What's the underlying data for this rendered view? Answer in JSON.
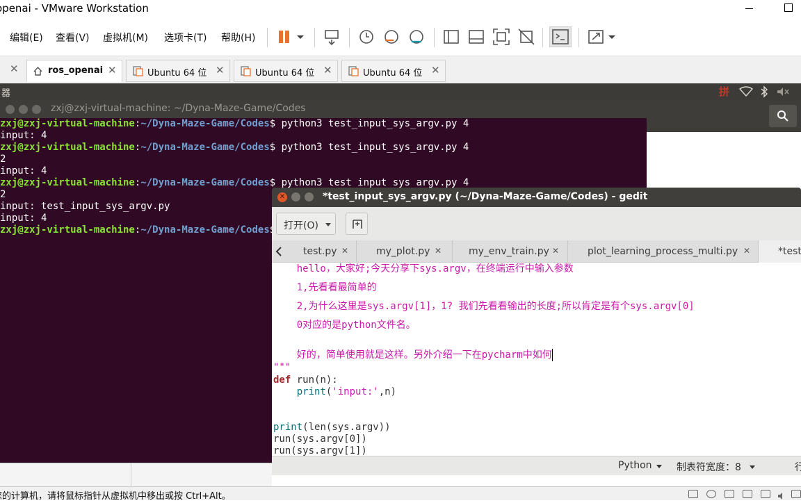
{
  "window": {
    "title": "openai - VMware Workstation"
  },
  "menu": {
    "items": [
      "编辑(E)",
      "查看(V)",
      "虚拟机(M)",
      "选项卡(T)",
      "帮助(H)"
    ]
  },
  "vm_tabs": [
    {
      "label": "ros_openai",
      "active": true
    },
    {
      "label": "Ubuntu 64 位",
      "active": false
    },
    {
      "label": "Ubuntu 64 位",
      "active": false
    },
    {
      "label": "Ubuntu 64 位",
      "active": false
    }
  ],
  "ubuntu_panel": {
    "left_label": "器"
  },
  "terminal": {
    "title": "zxj@zxj-virtual-machine: ~/Dyna-Maze-Game/Codes",
    "prompt_user": "zxj@zxj-virtual-machine",
    "prompt_path": "~/Dyna-Maze-Game/Codes",
    "command": "python3 test_input_sys_argv.py 4",
    "outputs": [
      "input: 4",
      "2",
      "input: 4",
      "2",
      "input: test_input_sys_argv.py",
      "input: 4"
    ]
  },
  "gedit": {
    "title": "*test_input_sys_argv.py (~/Dyna-Maze-Game/Codes) - gedit",
    "open_label": "打开(O)",
    "tabs": [
      "test.py",
      "my_plot.py",
      "my_env_train.py",
      "plot_learning_process_multi.py",
      "*test"
    ],
    "code": {
      "c1": "    hello，大家好;今天分享下sys.argv，在终端运行中输入参数",
      "c2": "    1,先看看最简单的",
      "c3": "    2,为什么这里是sys.argv[1]，1? 我们先看看输出的长度;所以肯定是有个sys.argv[0]",
      "c4": "    0对应的是python文件名。",
      "c5": "    好的，简单使用就是这样。另外介绍一下在pycharm中如何",
      "docend": "\"\"\"",
      "def_kw": "def",
      "def_rest": " run(n):",
      "print_kw": "    print",
      "print_rest1": "(",
      "print_str": "'input:'",
      "print_rest2": ",n)",
      "l_print_len": "print",
      "l_print_len_rest": "(len(sys.argv))",
      "l_run0": "run(sys.argv[0])",
      "l_run1": "run(sys.argv[1])"
    },
    "status": {
      "language": "Python",
      "tab_width": "制表符宽度：8",
      "position": "行"
    }
  },
  "vm_status": {
    "message": "您的计算机，请将鼠标指针从虚拟机中移出或按 Ctrl+Alt。"
  }
}
